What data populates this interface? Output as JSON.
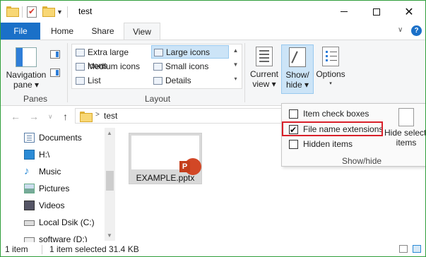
{
  "window": {
    "title": "test",
    "controls": {
      "minimize": "minimize",
      "maximize": "maximize",
      "close": "✕"
    }
  },
  "tabs": {
    "file": "File",
    "home": "Home",
    "share": "Share",
    "view": "View",
    "help": "?"
  },
  "ribbon": {
    "panes": {
      "nav_pane_line1": "Navigation",
      "nav_pane_line2": "pane ▾",
      "group": "Panes"
    },
    "layout": {
      "items": [
        "Extra large icons",
        "Large icons",
        "Medium icons",
        "Small icons",
        "List",
        "Details"
      ],
      "selected": "Large icons",
      "group": "Layout"
    },
    "current_view": {
      "line1": "Current",
      "line2": "view ▾"
    },
    "show_hide": {
      "line1": "Show/",
      "line2": "hide ▾"
    },
    "options": {
      "label": "Options",
      "arrow": "▾"
    }
  },
  "popup": {
    "item_check_boxes": {
      "label": "Item check boxes",
      "checked": false
    },
    "file_name_extensions": {
      "label": "File name extensions",
      "checked": true
    },
    "hidden_items": {
      "label": "Hidden items",
      "checked": false
    },
    "hide_selected_line1": "Hide selecte",
    "hide_selected_line2": "items",
    "group": "Show/hide"
  },
  "address": {
    "path": "test",
    "chevron": ">"
  },
  "nav": {
    "items": [
      "Documents",
      "H:\\",
      "Music",
      "Pictures",
      "Videos",
      "Local Dsik (C:)",
      "software (D:)"
    ]
  },
  "files": [
    {
      "name": "EXAMPLE.pptx",
      "icon": "powerpoint-icon",
      "badge": "P"
    }
  ],
  "status": {
    "count": "1 item",
    "selected": "1 item selected",
    "size": "31.4 KB"
  },
  "colors": {
    "accent": "#1a70c8",
    "highlight_border": "#d9202a",
    "selection": "#cce4f7",
    "powerpoint": "#d24726"
  }
}
